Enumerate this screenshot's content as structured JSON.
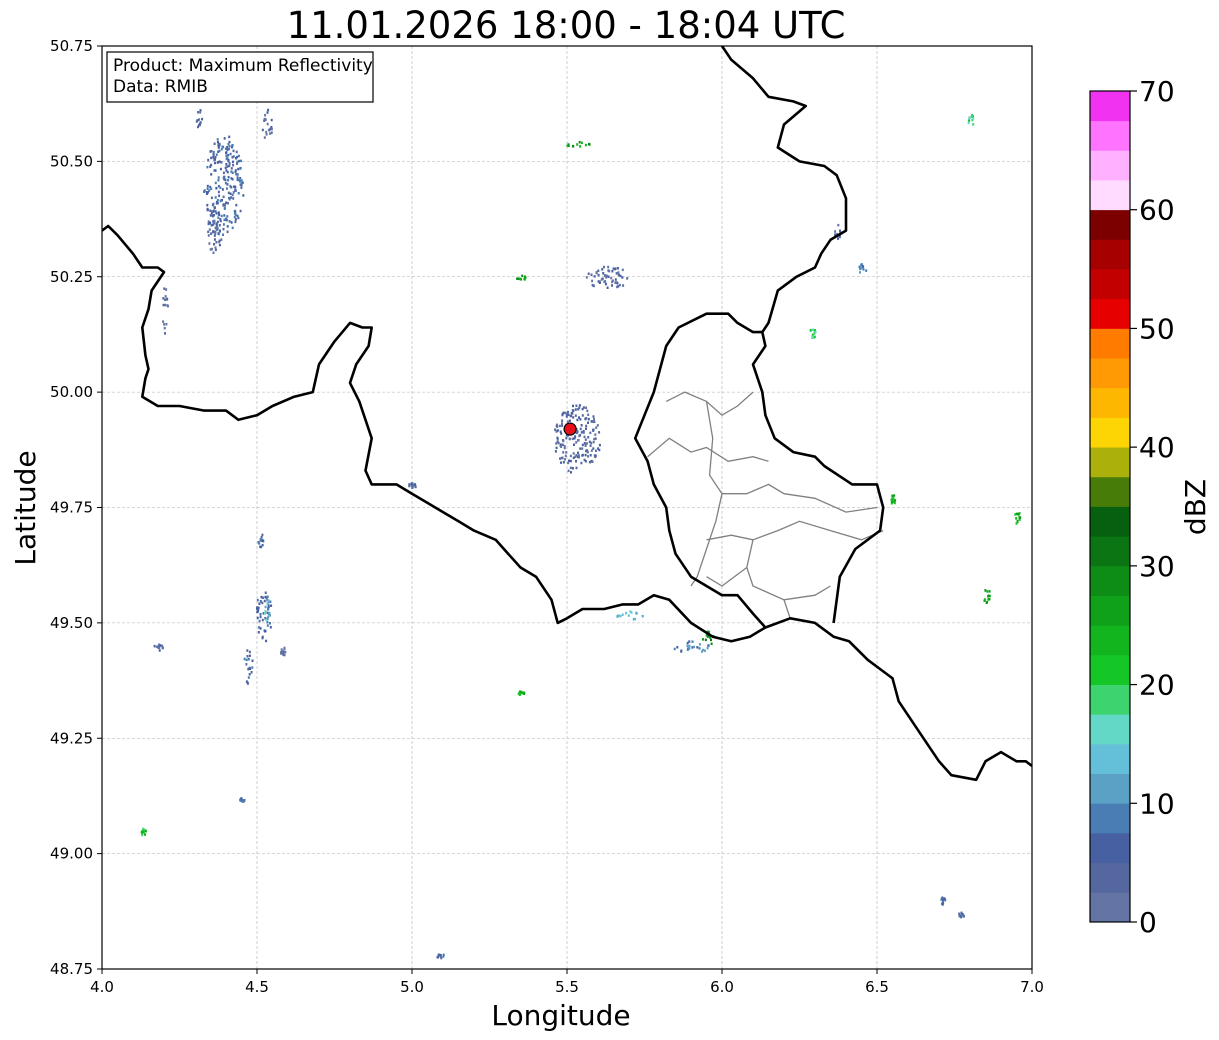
{
  "title": "11.01.2026 18:00 - 18:04 UTC",
  "xlabel": "Longitude",
  "ylabel": "Latitude",
  "info": {
    "product": "Product: Maximum Reflectivity",
    "source": "Data: RMIB"
  },
  "xticks": [
    "4.0",
    "4.5",
    "5.0",
    "5.5",
    "6.0",
    "6.5",
    "7.0"
  ],
  "yticks": [
    "50.75",
    "50.50",
    "50.25",
    "50.00",
    "49.75",
    "49.50",
    "49.25",
    "49.00",
    "48.75"
  ],
  "map_extent": {
    "lon": [
      4.0,
      7.0
    ],
    "lat": [
      48.75,
      50.75
    ]
  },
  "radar_site": {
    "lon": 5.51,
    "lat": 49.92,
    "color": "#e8101a"
  },
  "colorbar": {
    "label": "dBZ",
    "range": [
      0,
      70
    ],
    "tick_labels": [
      "0",
      "10",
      "20",
      "30",
      "40",
      "50",
      "60",
      "70"
    ],
    "colors": [
      "#6475a5",
      "#55679f",
      "#4660a1",
      "#4a7db3",
      "#5ba1c6",
      "#64c0d8",
      "#63d8c6",
      "#3dd46f",
      "#14c626",
      "#12b51e",
      "#0fa119",
      "#0d8c16",
      "#0a7512",
      "#07600f",
      "#487c09",
      "#acb00a",
      "#fed504",
      "#feb700",
      "#ff9904",
      "#ff7c00",
      "#e60000",
      "#c20000",
      "#a60000",
      "#7c0000",
      "#ffdcff",
      "#ffb0ff",
      "#fe74fe",
      "#f132f1"
    ]
  },
  "country_borders": [
    [
      [
        4.0,
        50.35
      ],
      [
        4.02,
        50.36
      ],
      [
        4.05,
        50.34
      ],
      [
        4.1,
        50.3
      ],
      [
        4.13,
        50.27
      ],
      [
        4.18,
        50.27
      ],
      [
        4.2,
        50.26
      ],
      [
        4.16,
        50.22
      ],
      [
        4.15,
        50.18
      ],
      [
        4.13,
        50.14
      ],
      [
        4.14,
        50.08
      ],
      [
        4.15,
        50.05
      ],
      [
        4.14,
        50.03
      ],
      [
        4.13,
        49.99
      ],
      [
        4.18,
        49.97
      ],
      [
        4.25,
        49.97
      ],
      [
        4.33,
        49.96
      ],
      [
        4.4,
        49.96
      ],
      [
        4.44,
        49.94
      ],
      [
        4.5,
        49.95
      ],
      [
        4.55,
        49.97
      ],
      [
        4.62,
        49.99
      ],
      [
        4.68,
        50.0
      ],
      [
        4.7,
        50.06
      ],
      [
        4.75,
        50.11
      ],
      [
        4.8,
        50.15
      ],
      [
        4.84,
        50.14
      ],
      [
        4.87,
        50.14
      ],
      [
        4.86,
        50.1
      ],
      [
        4.82,
        50.06
      ],
      [
        4.8,
        50.02
      ],
      [
        4.83,
        49.98
      ],
      [
        4.85,
        49.94
      ],
      [
        4.87,
        49.9
      ],
      [
        4.85,
        49.83
      ],
      [
        4.87,
        49.8
      ],
      [
        4.95,
        49.8
      ],
      [
        5.0,
        49.78
      ],
      [
        5.05,
        49.76
      ],
      [
        5.1,
        49.74
      ],
      [
        5.15,
        49.72
      ],
      [
        5.2,
        49.7
      ],
      [
        5.27,
        49.68
      ],
      [
        5.31,
        49.65
      ],
      [
        5.35,
        49.62
      ],
      [
        5.4,
        49.6
      ],
      [
        5.45,
        49.55
      ],
      [
        5.47,
        49.5
      ],
      [
        5.5,
        49.51
      ],
      [
        5.55,
        49.53
      ],
      [
        5.62,
        49.53
      ],
      [
        5.68,
        49.54
      ],
      [
        5.73,
        49.54
      ],
      [
        5.78,
        49.56
      ],
      [
        5.83,
        49.55
      ],
      [
        5.9,
        49.5
      ],
      [
        5.97,
        49.47
      ],
      [
        6.03,
        49.46
      ],
      [
        6.09,
        49.47
      ],
      [
        6.14,
        49.49
      ],
      [
        6.22,
        49.51
      ],
      [
        6.3,
        49.5
      ],
      [
        6.36,
        49.47
      ],
      [
        6.41,
        49.46
      ],
      [
        6.47,
        49.42
      ],
      [
        6.55,
        49.38
      ],
      [
        6.57,
        49.33
      ],
      [
        6.6,
        49.3
      ],
      [
        6.65,
        49.25
      ],
      [
        6.7,
        49.2
      ],
      [
        6.74,
        49.17
      ],
      [
        6.82,
        49.16
      ],
      [
        6.85,
        49.2
      ],
      [
        6.9,
        49.22
      ],
      [
        6.95,
        49.2
      ],
      [
        6.98,
        49.2
      ],
      [
        7.0,
        49.19
      ]
    ],
    [
      [
        6.0,
        50.75
      ],
      [
        6.03,
        50.72
      ],
      [
        6.1,
        50.68
      ],
      [
        6.15,
        50.64
      ],
      [
        6.23,
        50.63
      ],
      [
        6.27,
        50.62
      ],
      [
        6.2,
        50.58
      ],
      [
        6.18,
        50.53
      ],
      [
        6.25,
        50.5
      ],
      [
        6.33,
        50.49
      ],
      [
        6.37,
        50.47
      ],
      [
        6.4,
        50.42
      ],
      [
        6.4,
        50.35
      ],
      [
        6.35,
        50.33
      ],
      [
        6.32,
        50.3
      ],
      [
        6.3,
        50.27
      ],
      [
        6.24,
        50.25
      ],
      [
        6.18,
        50.22
      ],
      [
        6.15,
        50.15
      ],
      [
        6.13,
        50.13
      ],
      [
        6.14,
        50.1
      ],
      [
        6.1,
        50.06
      ],
      [
        6.13,
        50.0
      ],
      [
        6.14,
        49.95
      ],
      [
        6.17,
        49.9
      ],
      [
        6.23,
        49.87
      ],
      [
        6.3,
        49.86
      ],
      [
        6.33,
        49.84
      ],
      [
        6.42,
        49.8
      ],
      [
        6.5,
        49.8
      ],
      [
        6.52,
        49.75
      ],
      [
        6.51,
        49.7
      ],
      [
        6.43,
        49.66
      ],
      [
        6.38,
        49.6
      ],
      [
        6.37,
        49.55
      ],
      [
        6.36,
        49.5
      ]
    ],
    [
      [
        6.14,
        49.49
      ],
      [
        6.1,
        49.52
      ],
      [
        6.05,
        49.56
      ],
      [
        6.0,
        49.56
      ],
      [
        5.9,
        49.6
      ],
      [
        5.85,
        49.65
      ],
      [
        5.83,
        49.7
      ],
      [
        5.82,
        49.75
      ],
      [
        5.78,
        49.8
      ],
      [
        5.76,
        49.85
      ],
      [
        5.72,
        49.9
      ],
      [
        5.75,
        49.95
      ],
      [
        5.78,
        50.0
      ],
      [
        5.8,
        50.05
      ],
      [
        5.82,
        50.1
      ],
      [
        5.86,
        50.14
      ],
      [
        5.95,
        50.17
      ],
      [
        6.02,
        50.17
      ],
      [
        6.05,
        50.15
      ],
      [
        6.1,
        50.13
      ],
      [
        6.13,
        50.13
      ]
    ]
  ],
  "internal_borders": [
    [
      [
        5.82,
        49.98
      ],
      [
        5.88,
        50.0
      ],
      [
        5.95,
        49.98
      ],
      [
        6.0,
        49.95
      ],
      [
        6.05,
        49.97
      ],
      [
        6.1,
        50.0
      ]
    ],
    [
      [
        5.76,
        49.86
      ],
      [
        5.83,
        49.9
      ],
      [
        5.9,
        49.87
      ],
      [
        5.95,
        49.88
      ],
      [
        6.02,
        49.85
      ],
      [
        6.1,
        49.86
      ],
      [
        6.15,
        49.85
      ]
    ],
    [
      [
        5.95,
        49.98
      ],
      [
        5.97,
        49.9
      ],
      [
        5.96,
        49.82
      ],
      [
        6.0,
        49.78
      ],
      [
        6.08,
        49.78
      ],
      [
        6.15,
        49.8
      ],
      [
        6.2,
        49.78
      ],
      [
        6.3,
        49.77
      ],
      [
        6.4,
        49.74
      ],
      [
        6.5,
        49.75
      ]
    ],
    [
      [
        6.0,
        49.78
      ],
      [
        5.98,
        49.72
      ],
      [
        5.95,
        49.66
      ],
      [
        5.92,
        49.6
      ],
      [
        5.9,
        49.58
      ]
    ],
    [
      [
        5.95,
        49.68
      ],
      [
        6.03,
        49.69
      ],
      [
        6.1,
        49.68
      ],
      [
        6.18,
        49.7
      ],
      [
        6.25,
        49.72
      ],
      [
        6.35,
        49.7
      ],
      [
        6.45,
        49.68
      ],
      [
        6.52,
        49.7
      ]
    ],
    [
      [
        6.1,
        49.68
      ],
      [
        6.08,
        49.62
      ],
      [
        6.1,
        49.58
      ],
      [
        6.2,
        49.55
      ],
      [
        6.3,
        49.56
      ],
      [
        6.35,
        49.58
      ]
    ],
    [
      [
        6.2,
        49.55
      ],
      [
        6.22,
        49.51
      ]
    ],
    [
      [
        6.08,
        49.62
      ],
      [
        6.0,
        49.58
      ],
      [
        5.95,
        49.6
      ]
    ]
  ],
  "echoes": [
    [
      4.39,
      50.45,
      0.13,
      0.22,
      2
    ],
    [
      4.36,
      50.35,
      0.05,
      0.1,
      1
    ],
    [
      4.31,
      50.6,
      0.025,
      0.05,
      1
    ],
    [
      4.53,
      50.58,
      0.035,
      0.07,
      1
    ],
    [
      4.2,
      50.18,
      0.02,
      0.1,
      0
    ],
    [
      4.52,
      49.52,
      0.05,
      0.12,
      2
    ],
    [
      4.53,
      49.53,
      0.02,
      0.05,
      5
    ],
    [
      4.47,
      49.41,
      0.03,
      0.08,
      2
    ],
    [
      4.51,
      49.68,
      0.02,
      0.03,
      2
    ],
    [
      4.18,
      49.45,
      0.03,
      0.015,
      1
    ],
    [
      4.58,
      49.44,
      0.02,
      0.02,
      1
    ],
    [
      4.13,
      49.05,
      0.02,
      0.015,
      8
    ],
    [
      4.45,
      49.12,
      0.015,
      0.01,
      2
    ],
    [
      5.09,
      48.78,
      0.04,
      0.008,
      2
    ],
    [
      5.53,
      50.54,
      0.1,
      0.01,
      10
    ],
    [
      5.63,
      50.25,
      0.14,
      0.05,
      1
    ],
    [
      5.53,
      49.9,
      0.15,
      0.15,
      1
    ],
    [
      5.9,
      49.45,
      0.12,
      0.025,
      3
    ],
    [
      5.7,
      49.52,
      0.09,
      0.02,
      5
    ],
    [
      5.95,
      49.47,
      0.05,
      0.03,
      11
    ],
    [
      6.45,
      50.27,
      0.03,
      0.02,
      3
    ],
    [
      6.37,
      50.35,
      0.02,
      0.03,
      1
    ],
    [
      6.85,
      49.56,
      0.03,
      0.03,
      10
    ],
    [
      6.95,
      49.73,
      0.025,
      0.025,
      9
    ],
    [
      6.71,
      48.9,
      0.015,
      0.015,
      2
    ],
    [
      6.77,
      48.87,
      0.02,
      0.01,
      2
    ],
    [
      6.8,
      50.59,
      0.02,
      0.03,
      7
    ],
    [
      5.35,
      50.25,
      0.03,
      0.01,
      10
    ],
    [
      5.0,
      49.8,
      0.03,
      0.01,
      2
    ],
    [
      5.35,
      49.35,
      0.02,
      0.01,
      9
    ],
    [
      6.55,
      49.77,
      0.02,
      0.02,
      9
    ],
    [
      6.29,
      50.13,
      0.02,
      0.02,
      7
    ]
  ]
}
